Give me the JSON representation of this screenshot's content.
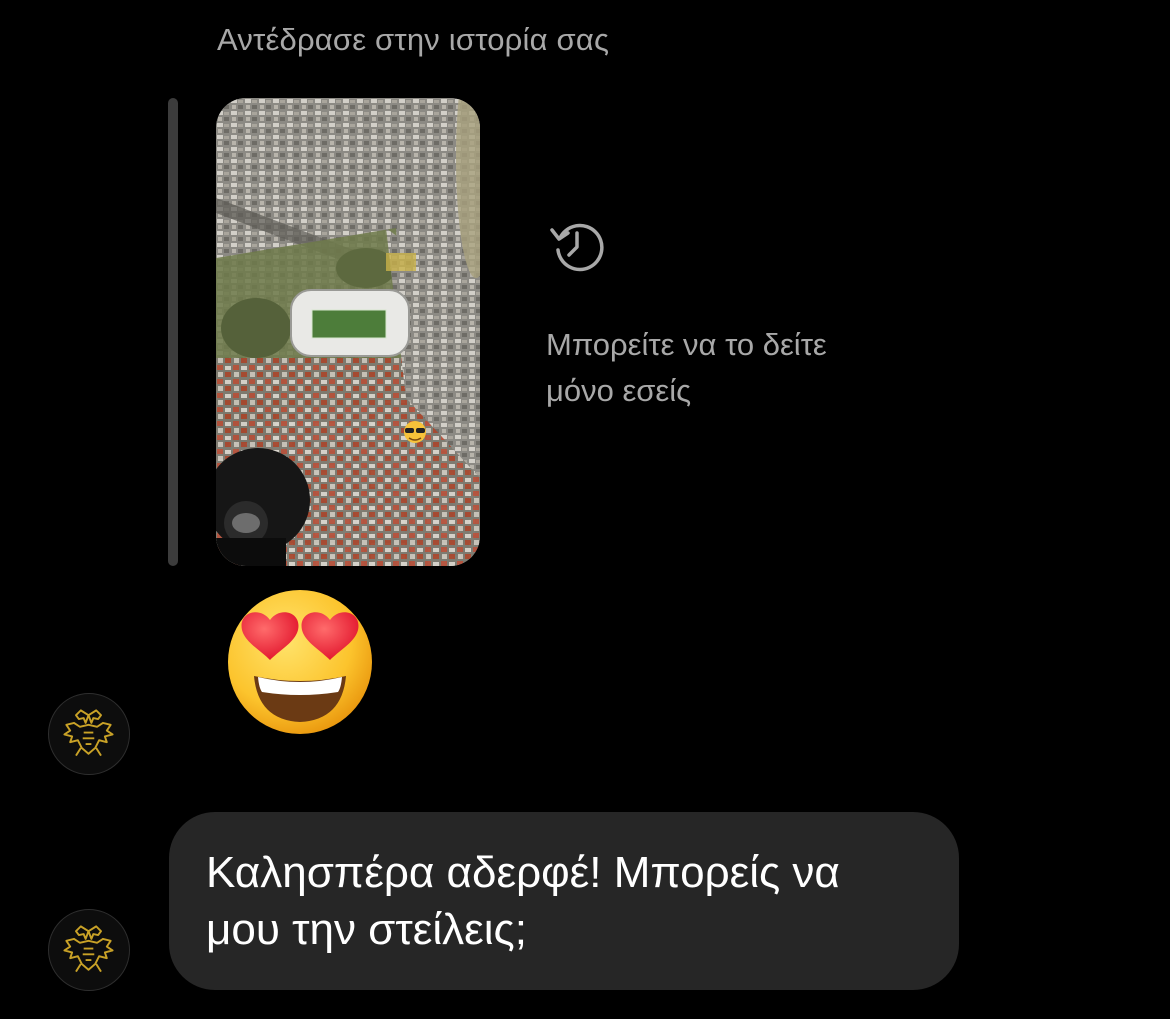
{
  "conversation": {
    "reply_header": "Αντέδρασε στην ιστορία σας",
    "story": {
      "private_notice": "Μπορείτε να το δείτε μόνο εσείς",
      "icon": "history-clock-icon"
    },
    "reaction": {
      "emoji": "smiling-face-with-heart-eyes",
      "glyph": "😍"
    },
    "messages": [
      {
        "text": "Καλησπέρα αδερφέ! Μπορείς να μου την στείλεις;"
      }
    ],
    "avatar_icon": "golden-double-headed-eagle-icon"
  },
  "colors": {
    "background": "#000000",
    "bubble": "#262626",
    "secondary_text": "#a8a8a8",
    "primary_text": "#ffffff",
    "avatar_gold": "#c9a227"
  }
}
